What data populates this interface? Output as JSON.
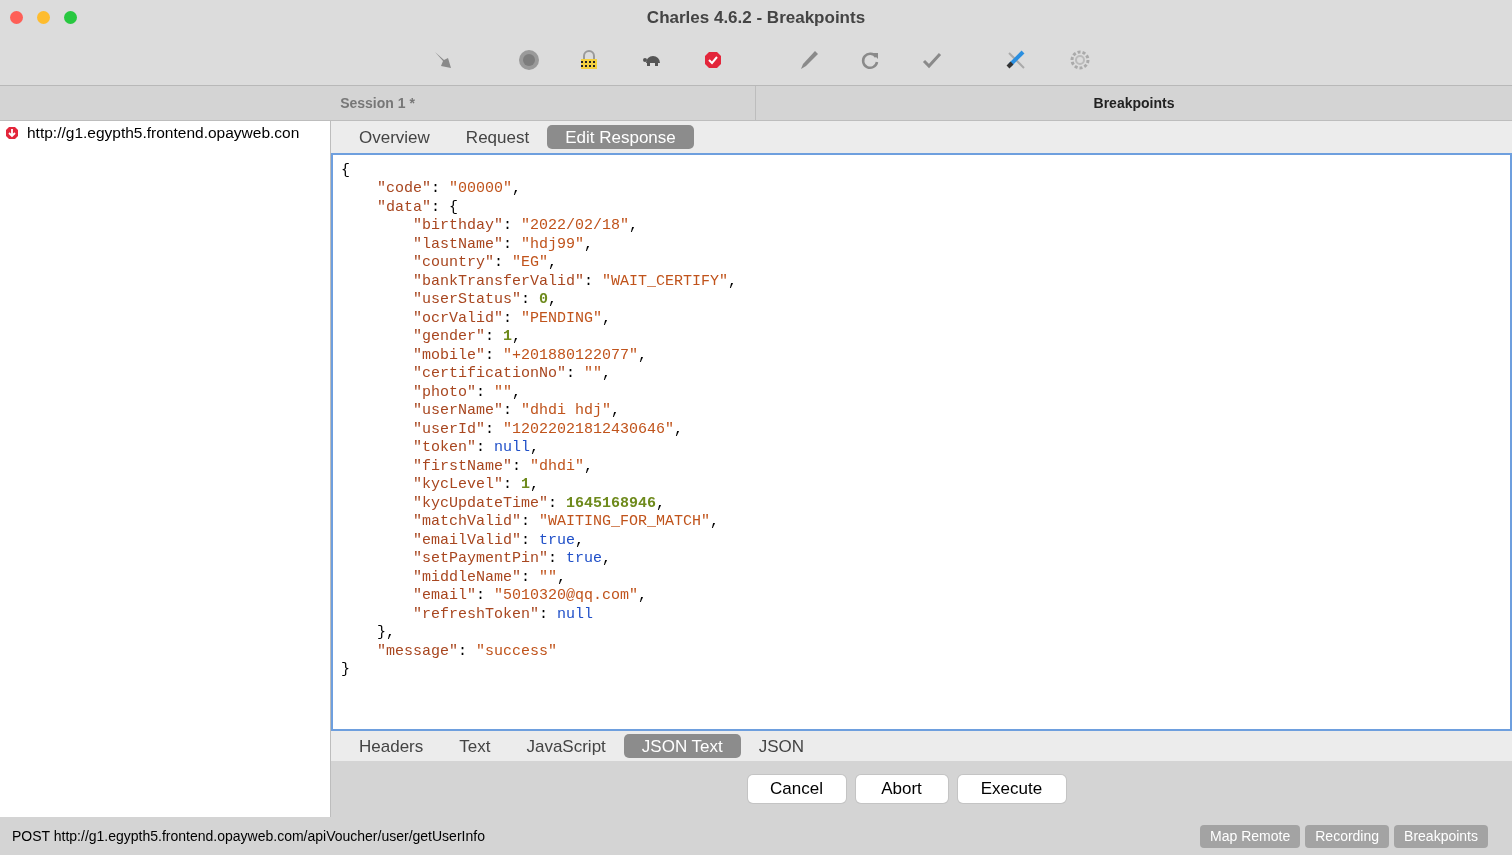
{
  "window": {
    "title": "Charles 4.6.2 - Breakpoints"
  },
  "panes": [
    {
      "label": "Session 1 *",
      "selected": false
    },
    {
      "label": "Breakpoints",
      "selected": true
    }
  ],
  "requests": [
    {
      "url": "http://g1.egypth5.frontend.opayweb.con",
      "selected": false
    }
  ],
  "tabs": [
    {
      "label": "Overview",
      "selected": false
    },
    {
      "label": "Request",
      "selected": false
    },
    {
      "label": "Edit Response",
      "selected": true
    }
  ],
  "editor_lines": [
    "{",
    "    \"code\": \"00000\",",
    "    \"data\": {",
    "        \"birthday\": \"2022/02/18\",",
    "        \"lastName\": \"hdj99\",",
    "        \"country\": \"EG\",",
    "        \"bankTransferValid\": \"WAIT_CERTIFY\",",
    "        \"userStatus\": 0,",
    "        \"ocrValid\": \"PENDING\",",
    "        \"gender\": 1,",
    "        \"mobile\": \"+201880122077\",",
    "        \"certificationNo\": \"\",",
    "        \"photo\": \"\",",
    "        \"userName\": \"dhdi hdj\",",
    "        \"userId\": \"12022021812430646\",",
    "        \"token\": null,",
    "        \"firstName\": \"dhdi\",",
    "        \"kycLevel\": 1,",
    "        \"kycUpdateTime\": 1645168946,",
    "        \"matchValid\": \"WAITING_FOR_MATCH\",",
    "        \"emailValid\": true,",
    "        \"setPaymentPin\": true,",
    "        \"middleName\": \"\",",
    "        \"email\": \"5010320@qq.com\",",
    "        \"refreshToken\": null",
    "    },",
    "    \"message\": \"success\"",
    "}"
  ],
  "view_tabs": [
    {
      "label": "Headers",
      "selected": false
    },
    {
      "label": "Text",
      "selected": false
    },
    {
      "label": "JavaScript",
      "selected": false
    },
    {
      "label": "JSON Text",
      "selected": true
    },
    {
      "label": "JSON",
      "selected": false
    }
  ],
  "buttons": [
    "Cancel",
    "Abort",
    "Execute"
  ],
  "status_bar": {
    "text": "POST http://g1.egypth5.frontend.opayweb.com/apiVoucher/user/getUserInfo",
    "toggles": [
      "Map Remote",
      "Recording",
      "Breakpoints"
    ]
  }
}
